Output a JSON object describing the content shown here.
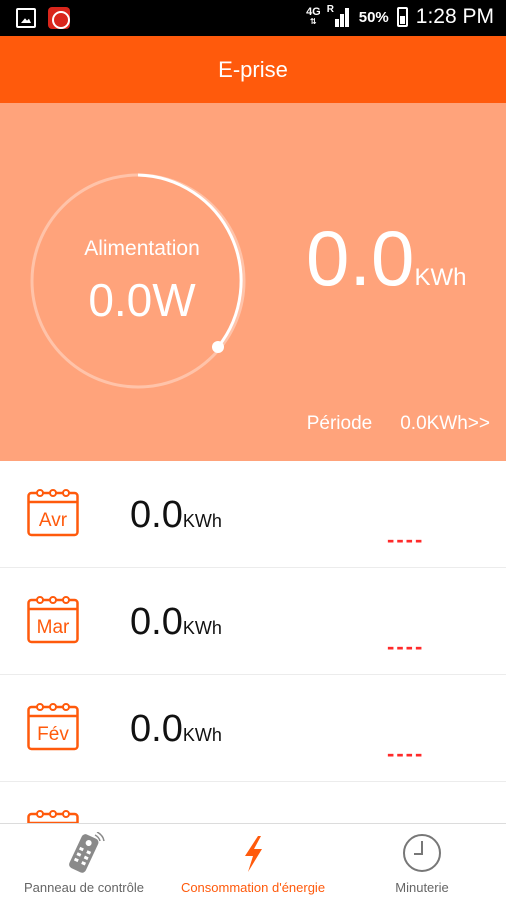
{
  "status_bar": {
    "network_top": "4G",
    "network_roaming": "R",
    "battery": "50%",
    "time": "1:28 PM"
  },
  "header": {
    "title": "E-prise"
  },
  "summary": {
    "gauge_label": "Alimentation",
    "gauge_value": "0.0W",
    "total_value": "0.0",
    "total_unit": "KWh",
    "period_label": "Période",
    "period_value": "0.0KWh>>"
  },
  "months": [
    {
      "label": "Avr",
      "value": "0.0",
      "unit": "KWh",
      "delta": "----"
    },
    {
      "label": "Mar",
      "value": "0.0",
      "unit": "KWh",
      "delta": "----"
    },
    {
      "label": "Fév",
      "value": "0.0",
      "unit": "KWh",
      "delta": "----"
    }
  ],
  "nav": {
    "items": [
      {
        "label": "Panneau de contrôle",
        "icon": "remote-control-icon",
        "active": false
      },
      {
        "label": "Consommation d'énergie",
        "icon": "lightning-icon",
        "active": true
      },
      {
        "label": "Minuterie",
        "icon": "clock-icon",
        "active": false
      }
    ]
  },
  "colors": {
    "accent": "#ff5a0c",
    "hero_background": "#ffa37b",
    "delta": "#ff2a2a"
  }
}
